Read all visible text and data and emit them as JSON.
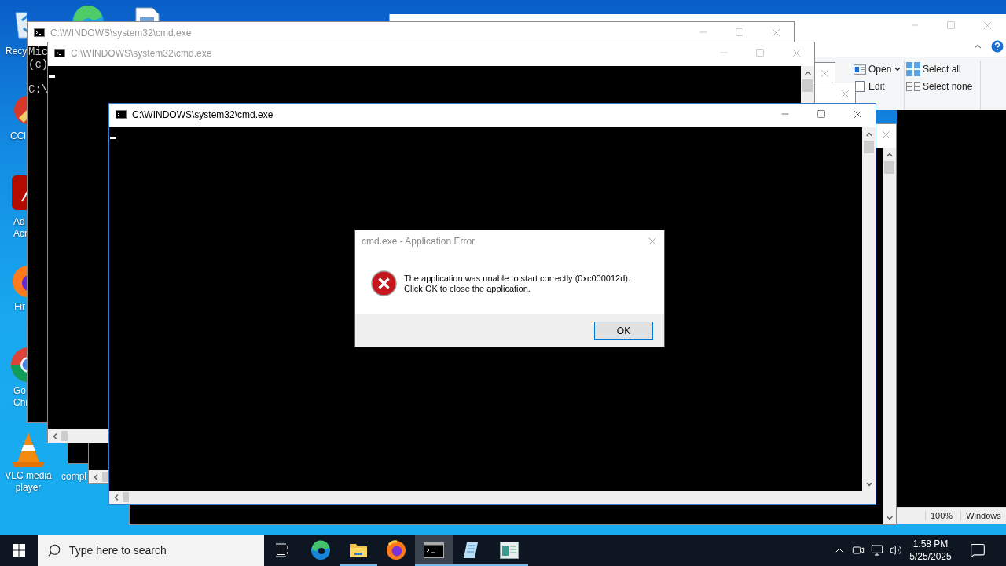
{
  "desktop_icons": [
    {
      "kind": "recycle-bin",
      "label": [
        "Recy"
      ]
    },
    {
      "kind": "browser"
    },
    {
      "kind": "document"
    },
    {
      "kind": "cleaner",
      "label": [
        "CCl"
      ]
    },
    {
      "kind": "pdf",
      "label": [
        "Ad",
        "Acr"
      ]
    },
    {
      "kind": "firefox",
      "label": [
        "Fir"
      ]
    },
    {
      "kind": "chrome",
      "label": [
        "Go",
        "Chr"
      ]
    },
    {
      "kind": "cone",
      "label": [
        "VLC media",
        "player"
      ]
    },
    {
      "kind": "none",
      "label": [
        "compl"
      ]
    }
  ],
  "explorer": {
    "ribbon": [
      {
        "kind": "open",
        "label": "Open"
      },
      {
        "kind": "edit",
        "label": "Edit"
      },
      {
        "kind": "select-all",
        "label": "Select all"
      },
      {
        "kind": "select-none",
        "label": "Select none"
      }
    ]
  },
  "editor": {
    "status": [
      "100%",
      "Windows"
    ]
  },
  "consoles": [
    {
      "kind": "full",
      "title": "C:\\WINDOWS\\system32\\cmd.exe",
      "active": false,
      "blocks": [
        [
          "Mic",
          "(c)"
        ],
        [
          "C:\\"
        ]
      ]
    },
    {
      "kind": "full",
      "title": "C:\\WINDOWS\\system32\\cmd.exe",
      "active": false,
      "cursor": true,
      "vscroll": true,
      "hscroll": true
    },
    {
      "kind": "partial",
      "active": false
    },
    {
      "kind": "partial",
      "active": false,
      "hscroll": true
    },
    {
      "kind": "partial",
      "active": false,
      "vscroll": true
    },
    {
      "kind": "full",
      "title": "C:\\WINDOWS\\system32\\cmd.exe",
      "active": true,
      "cursor": true,
      "vscroll": true,
      "hscroll": true
    }
  ],
  "dialog": {
    "title": "cmd.exe - Application Error",
    "message": [
      "The application was unable to start correctly (0xc000012d).",
      "Click OK to close the application."
    ],
    "button": "OK"
  },
  "taskbar": {
    "search_placeholder": "Type here to search",
    "apps": [
      {
        "kind": "task-view",
        "running": false,
        "active": false
      },
      {
        "kind": "edge",
        "running": false,
        "active": false
      },
      {
        "kind": "folder",
        "running": true,
        "active": false
      },
      {
        "kind": "firefox",
        "running": false,
        "active": false
      },
      {
        "kind": "console",
        "running": true,
        "active": true
      },
      {
        "kind": "notepad",
        "running": true,
        "active": false
      },
      {
        "kind": "viewer",
        "running": true,
        "active": false
      }
    ],
    "clock": {
      "time": "1:58 PM",
      "date": "5/25/2025"
    }
  }
}
